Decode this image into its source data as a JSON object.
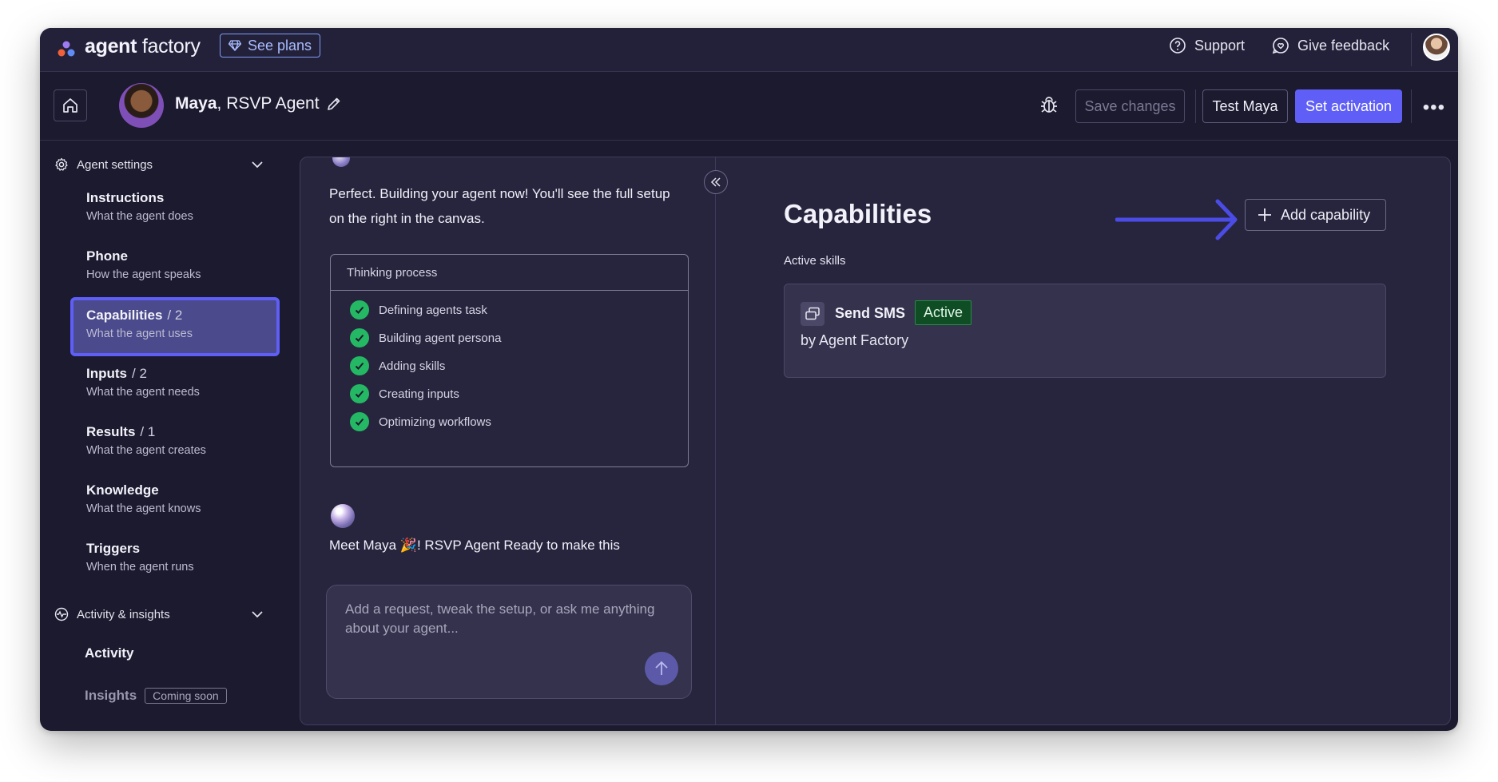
{
  "app": {
    "brand_bold": "agent",
    "brand_rest": " factory"
  },
  "topbar": {
    "see_plans": "See plans",
    "support": "Support",
    "feedback": "Give feedback"
  },
  "agent": {
    "name": "Maya",
    "role": ", RSVP Agent",
    "save_changes": "Save changes",
    "test": "Test Maya",
    "set_activation": "Set activation"
  },
  "sidebar": {
    "settings_label": "Agent settings",
    "items": [
      {
        "title": "Instructions",
        "count": "",
        "desc": "What the agent does"
      },
      {
        "title": "Phone",
        "count": "",
        "desc": "How the agent speaks"
      },
      {
        "title": "Capabilities",
        "count": "/ 2",
        "desc": "What the agent uses"
      },
      {
        "title": "Inputs",
        "count": "/ 2",
        "desc": "What the agent needs"
      },
      {
        "title": "Results",
        "count": "/ 1",
        "desc": "What the agent creates"
      },
      {
        "title": "Knowledge",
        "count": "",
        "desc": "What the agent knows"
      },
      {
        "title": "Triggers",
        "count": "",
        "desc": "When the agent runs"
      }
    ],
    "activity_label": "Activity & insights",
    "activity": "Activity",
    "insights": "Insights",
    "coming_soon": "Coming soon"
  },
  "chat": {
    "message1": "Perfect. Building your agent now! You'll see the full setup on the right in the canvas.",
    "thinking_title": "Thinking process",
    "steps": [
      "Defining agents task",
      "Building agent persona",
      "Adding skills",
      "Creating inputs",
      "Optimizing workflows"
    ],
    "message2": "Meet Maya 🎉! RSVP Agent Ready to make this",
    "composer_placeholder": "Add a request, tweak the setup, or ask me anything about your agent..."
  },
  "canvas": {
    "title": "Capabilities",
    "add_capability": "Add capability",
    "active_skills_label": "Active skills",
    "skill": {
      "name": "Send SMS",
      "status": "Active",
      "by": "by Agent Factory"
    }
  },
  "colors": {
    "accent": "#5f5ff7",
    "success": "#25b864",
    "background": "#1b1a2e"
  }
}
